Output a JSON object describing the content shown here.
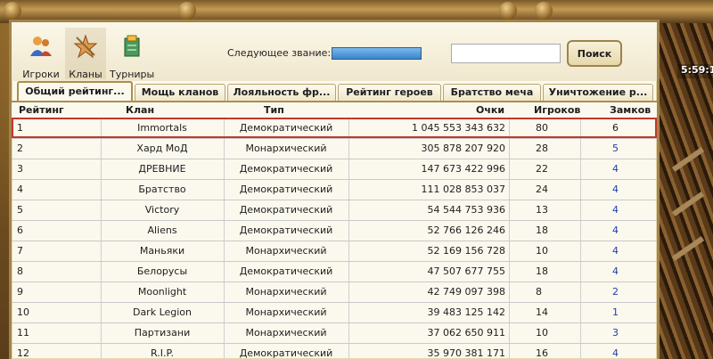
{
  "clock": "5:59:1",
  "nav": {
    "players": {
      "label": "Игроки",
      "icon": "players-icon"
    },
    "clans": {
      "label": "Кланы",
      "icon": "clans-icon"
    },
    "tournaments": {
      "label": "Турниры",
      "icon": "tournaments-icon"
    }
  },
  "rank": {
    "label": "Следующее звание:",
    "progress": 1.0
  },
  "search": {
    "value": "",
    "button": "Поиск"
  },
  "tabs": [
    {
      "label": "Общий рейтинг..."
    },
    {
      "label": "Мощь кланов"
    },
    {
      "label": "Лояльность фр..."
    },
    {
      "label": "Рейтинг героев"
    },
    {
      "label": "Братство меча"
    },
    {
      "label": "Уничтожение р..."
    }
  ],
  "columns": {
    "rank": "Рейтинг",
    "clan": "Клан",
    "type": "Тип",
    "points": "Очки",
    "players": "Игроков",
    "castles": "Замков"
  },
  "rows": [
    {
      "rank": "1",
      "clan": "Immortals",
      "type": "Демократический",
      "points": "1 045 553 343 632",
      "players": "80",
      "castles": "6"
    },
    {
      "rank": "2",
      "clan": "Хард МоД",
      "type": "Монархический",
      "points": "305 878 207 920",
      "players": "28",
      "castles": "5"
    },
    {
      "rank": "3",
      "clan": "ДРЕВНИЕ",
      "type": "Демократический",
      "points": "147 673 422 996",
      "players": "22",
      "castles": "4"
    },
    {
      "rank": "4",
      "clan": "Братство",
      "type": "Демократический",
      "points": "111 028 853 037",
      "players": "24",
      "castles": "4"
    },
    {
      "rank": "5",
      "clan": "Victory",
      "type": "Демократический",
      "points": "54 544 753 936",
      "players": "13",
      "castles": "4"
    },
    {
      "rank": "6",
      "clan": "Aliens",
      "type": "Демократический",
      "points": "52 766 126 246",
      "players": "18",
      "castles": "4"
    },
    {
      "rank": "7",
      "clan": "Маньяки",
      "type": "Монархический",
      "points": "52 169 156 728",
      "players": "10",
      "castles": "4"
    },
    {
      "rank": "8",
      "clan": "Белорусы",
      "type": "Демократический",
      "points": "47 507 677 755",
      "players": "18",
      "castles": "4"
    },
    {
      "rank": "9",
      "clan": "Moonlight",
      "type": "Монархический",
      "points": "42 749 097 398",
      "players": "8",
      "castles": "2"
    },
    {
      "rank": "10",
      "clan": "Dark Legion",
      "type": "Монархический",
      "points": "39 483 125 142",
      "players": "14",
      "castles": "1"
    },
    {
      "rank": "11",
      "clan": "Партизани",
      "type": "Монархический",
      "points": "37 062 650 911",
      "players": "10",
      "castles": "3"
    },
    {
      "rank": "12",
      "clan": "R.I.P.",
      "type": "Демократический",
      "points": "35 970 381 171",
      "players": "16",
      "castles": "4"
    }
  ],
  "colors": {
    "accent_frame": "#a2844a",
    "selected_row": "#c0392b",
    "castle_link": "#1f3fa8"
  }
}
